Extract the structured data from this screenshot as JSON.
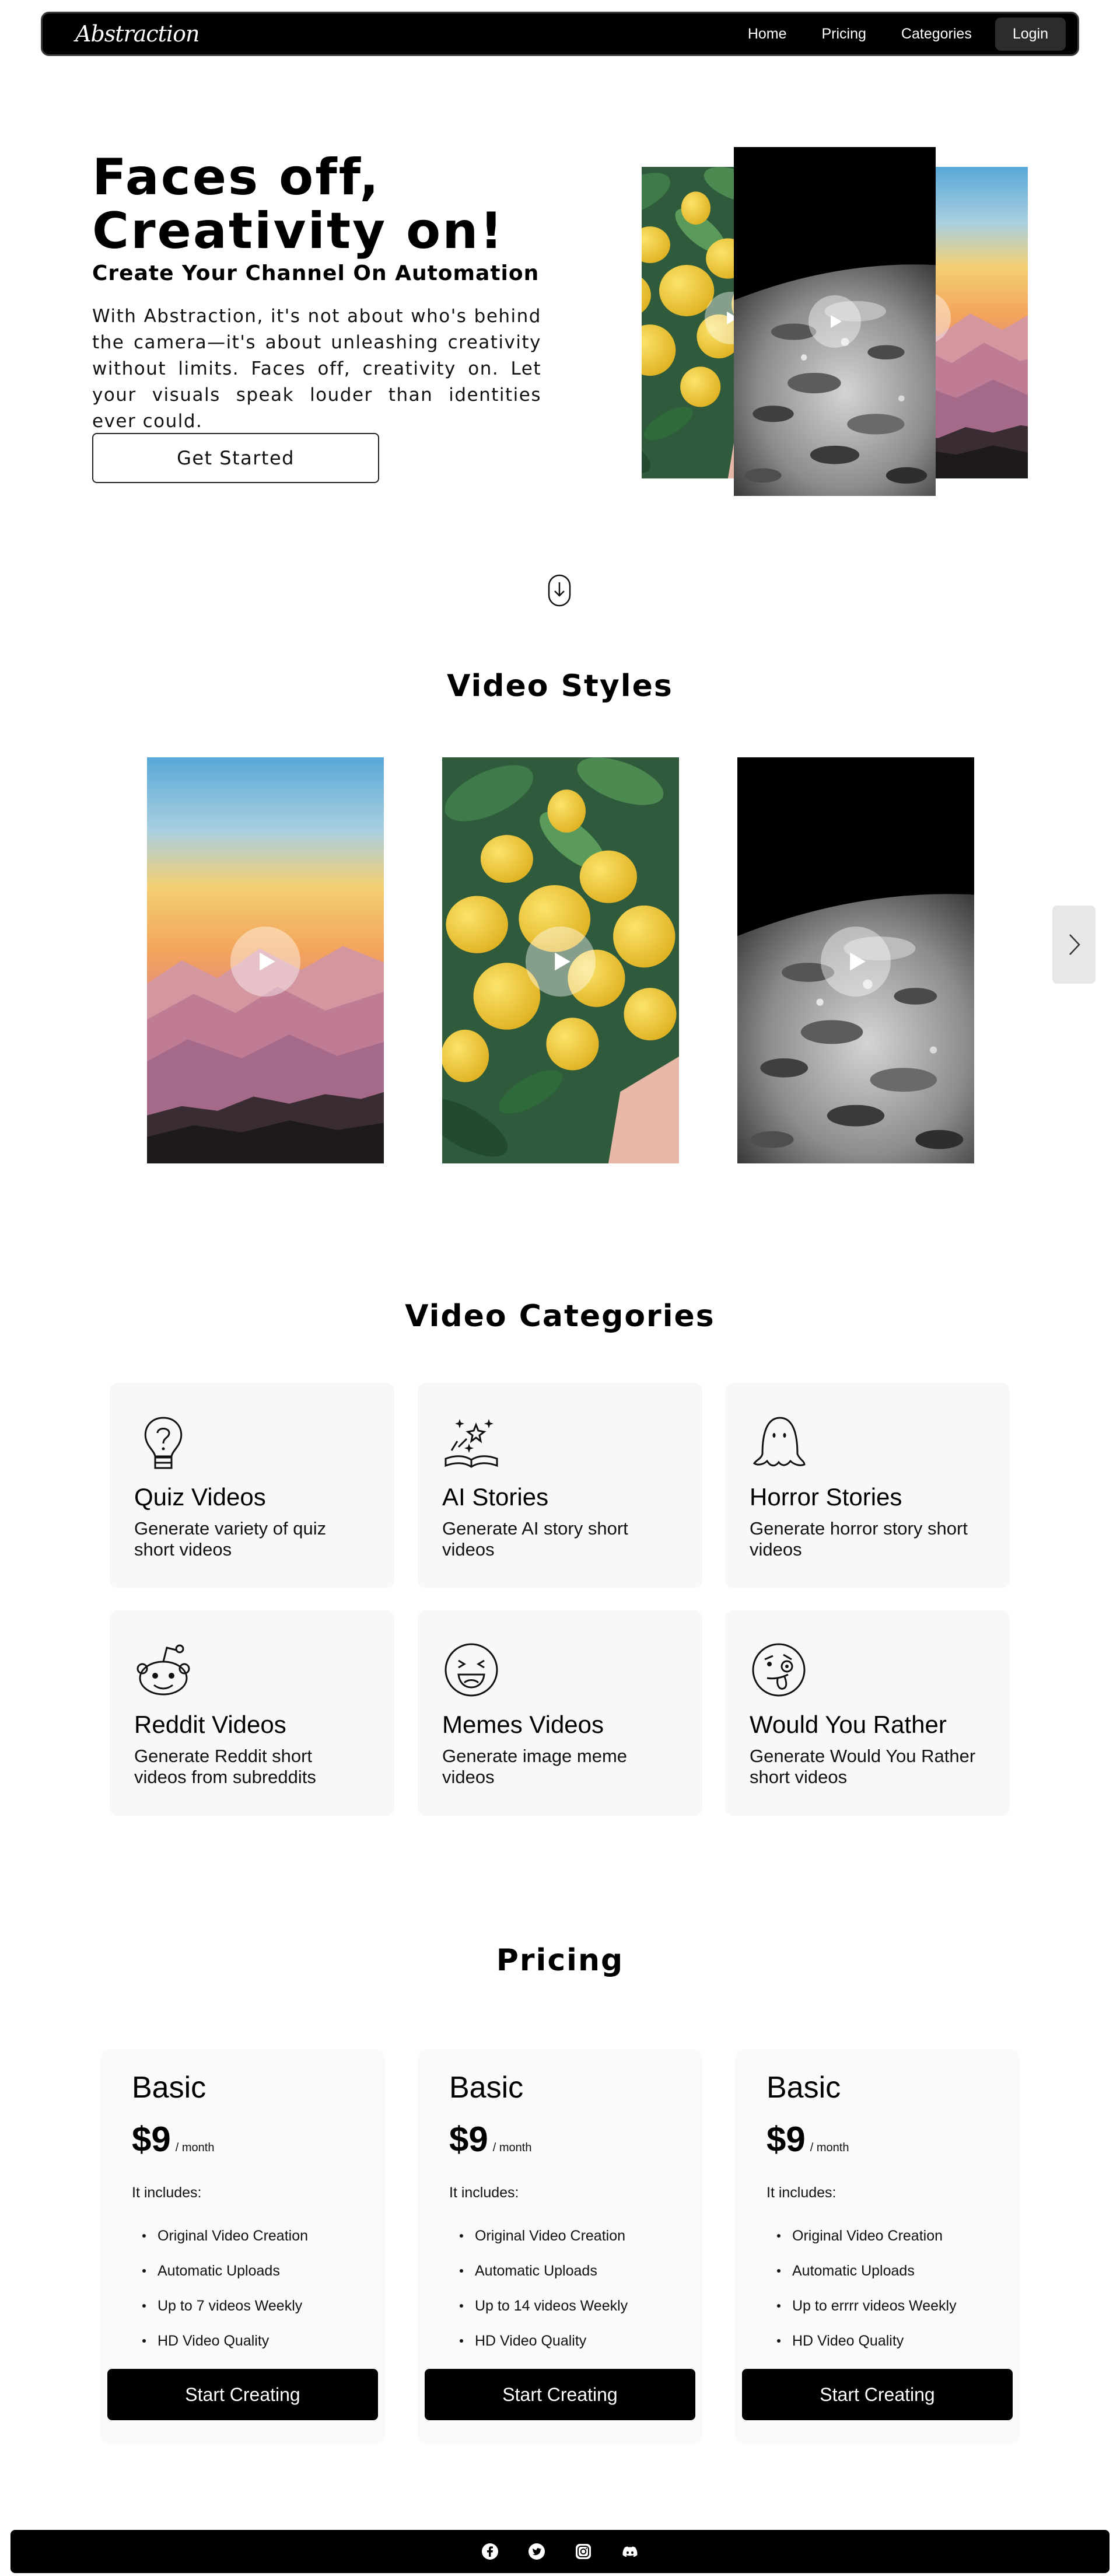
{
  "nav": {
    "brand": "Abstraction",
    "links": [
      "Home",
      "Pricing",
      "Categories"
    ],
    "login": "Login"
  },
  "hero": {
    "title_line1": "Faces off,",
    "title_line2": "Creativity on!",
    "subtitle": "Create Your Channel On Automation",
    "description": "With Abstraction, it's not about who's behind the camera—it's about unleashing creativity without limits. Faces off, creativity on. Let your visuals speak louder than identities ever could.",
    "cta": "Get Started",
    "thumbnails": [
      "lemons",
      "moon",
      "mountain-sunset"
    ]
  },
  "video_styles": {
    "title": "Video Styles",
    "cards": [
      "mountain-sunset",
      "lemons",
      "moon"
    ],
    "next_icon": "chevron-right-icon"
  },
  "categories": {
    "title": "Video Categories",
    "items": [
      {
        "icon": "lightbulb-question-icon",
        "title": "Quiz Videos",
        "desc": "Generate variety of quiz short videos"
      },
      {
        "icon": "magic-book-icon",
        "title": "AI Stories",
        "desc": "Generate AI story short videos"
      },
      {
        "icon": "ghost-icon",
        "title": "Horror Stories",
        "desc": "Generate horror story short videos"
      },
      {
        "icon": "reddit-icon",
        "title": "Reddit Videos",
        "desc": "Generate Reddit short videos from subreddits"
      },
      {
        "icon": "laughing-face-icon",
        "title": "Memes Videos",
        "desc": "Generate image meme videos"
      },
      {
        "icon": "tongue-out-face-icon",
        "title": "Would You Rather",
        "desc": "Generate Would You Rather short videos"
      }
    ]
  },
  "pricing": {
    "title": "Pricing",
    "plans": [
      {
        "name": "Basic",
        "price": "$9",
        "period": "/ month",
        "includes": "It includes:",
        "features": [
          "Original Video Creation",
          "Automatic Uploads",
          "Up to 7 videos Weekly",
          "HD Video Quality"
        ],
        "cta": "Start Creating"
      },
      {
        "name": "Basic",
        "price": "$9",
        "period": "/ month",
        "includes": "It includes:",
        "features": [
          "Original Video Creation",
          "Automatic Uploads",
          "Up to 14 videos Weekly",
          "HD Video Quality"
        ],
        "cta": "Start Creating"
      },
      {
        "name": "Basic",
        "price": "$9",
        "period": "/ month",
        "includes": "It includes:",
        "features": [
          "Original Video Creation",
          "Automatic Uploads",
          "Up to errrr videos Weekly",
          "HD Video Quality"
        ],
        "cta": "Start Creating"
      }
    ]
  },
  "footer": {
    "social_icons": [
      "facebook-icon",
      "twitter-icon",
      "instagram-icon",
      "discord-icon"
    ]
  }
}
